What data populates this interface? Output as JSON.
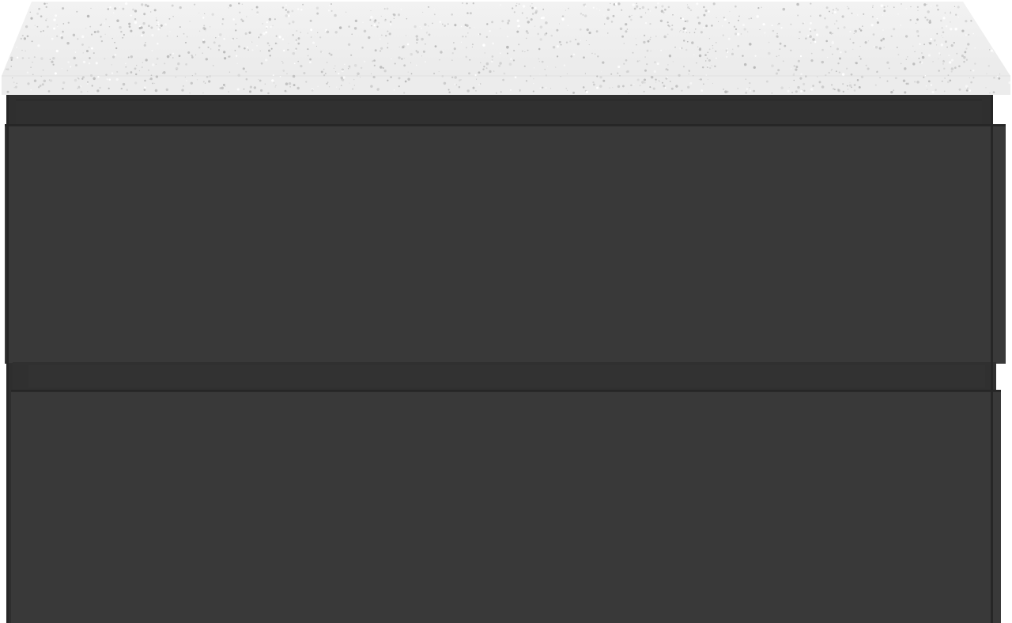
{
  "scene": {
    "subject": "vanity-cabinet",
    "colors": {
      "countertop": "#efefef",
      "countertop_speckle_dark": "#b8b8b8",
      "countertop_speckle_light": "#ffffff",
      "cabinet_body": "#2e2e2e",
      "drawer_front": "#393939",
      "shadow_line": "#262626",
      "background": "#ffffff"
    },
    "drawers": [
      {
        "name": "top-drawer"
      },
      {
        "name": "bottom-drawer"
      }
    ]
  }
}
